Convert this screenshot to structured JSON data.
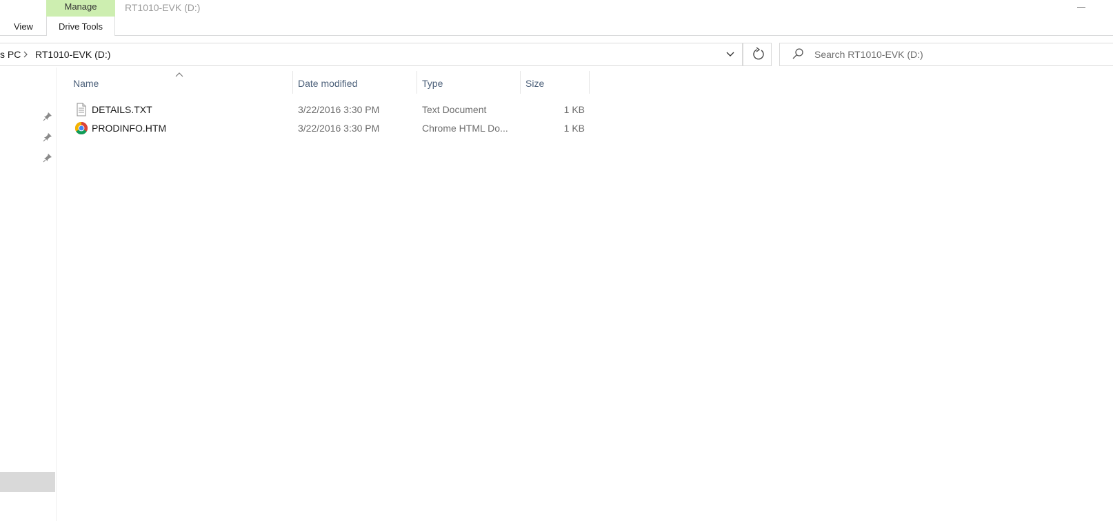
{
  "ribbon": {
    "contextual_tab_group": "Manage",
    "tabs": [
      "View",
      "Drive Tools"
    ],
    "window_title": "RT1010-EVK (D:)"
  },
  "address_bar": {
    "crumbs": [
      "s PC",
      "RT1010-EVK (D:)"
    ],
    "separator": ">"
  },
  "search": {
    "placeholder": "Search RT1010-EVK (D:)"
  },
  "columns": {
    "name": "Name",
    "date": "Date modified",
    "type": "Type",
    "size": "Size"
  },
  "files": [
    {
      "name": "DETAILS.TXT",
      "date": "3/22/2016 3:30 PM",
      "type": "Text Document",
      "size": "1 KB",
      "icon": "text-document-icon"
    },
    {
      "name": "PRODINFO.HTM",
      "date": "3/22/2016 3:30 PM",
      "type": "Chrome HTML Do...",
      "size": "1 KB",
      "icon": "chrome-icon"
    }
  ],
  "colors": {
    "manage_tab": "#cdeeb0",
    "header_text": "#4c607a",
    "selection": "#d9d9d9"
  }
}
